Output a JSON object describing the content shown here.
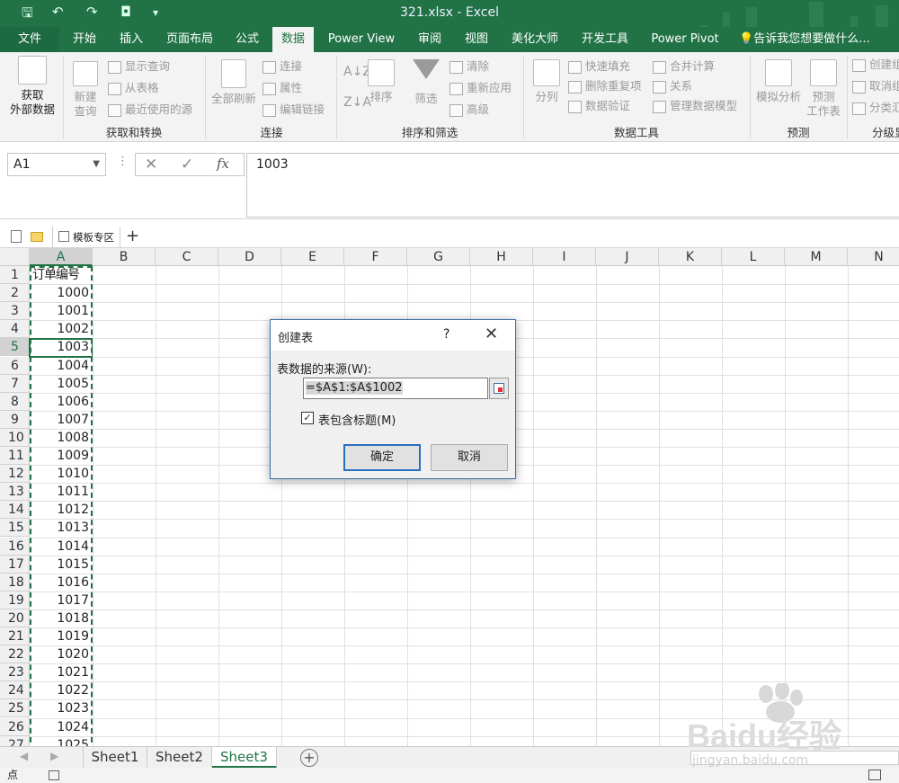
{
  "window": {
    "title": "321.xlsx - Excel"
  },
  "tabs": [
    "文件",
    "开始",
    "插入",
    "页面布局",
    "公式",
    "数据",
    "Power View",
    "审阅",
    "视图",
    "美化大师",
    "开发工具",
    "Power Pivot"
  ],
  "active_tab": "数据",
  "tell_me": "告诉我您想要做什么...",
  "ribbon": {
    "get_external": {
      "line1": "获取",
      "line2": "外部数据"
    },
    "new_query": {
      "line1": "新建",
      "line2": "查询"
    },
    "show_query": "显示查询",
    "from_table": "从表格",
    "recent_sources": "最近使用的源",
    "group_get_transform": "获取和转换",
    "refresh_all": "全部刷新",
    "connections": "连接",
    "properties": "属性",
    "edit_links": "编辑链接",
    "group_connections": "连接",
    "sort": "排序",
    "filter": "筛选",
    "clear": "清除",
    "reapply": "重新应用",
    "advanced": "高级",
    "group_sort_filter": "排序和筛选",
    "text_to_columns": "分列",
    "flash_fill": "快速填充",
    "remove_duplicates": "删除重复项",
    "data_validation": "数据验证",
    "consolidate": "合并计算",
    "relationships": "关系",
    "manage_data_model": "管理数据模型",
    "group_data_tools": "数据工具",
    "what_if": "模拟分析",
    "forecast_sheet": {
      "line1": "预测",
      "line2": "工作表"
    },
    "group_forecast": "预测",
    "group_create": "创建组",
    "ungroup": "取消组",
    "subtotal": "分类汇",
    "group_outline": "分级显"
  },
  "formula_bar": {
    "name_box": "A1",
    "fx": "fx",
    "value": "1003"
  },
  "template_tab": "模板专区",
  "columns": [
    "A",
    "B",
    "C",
    "D",
    "E",
    "F",
    "G",
    "H",
    "I",
    "J",
    "K",
    "L",
    "M",
    "N"
  ],
  "rows": [
    {
      "n": "1",
      "a": "订单编号"
    },
    {
      "n": "2",
      "a": "1000"
    },
    {
      "n": "3",
      "a": "1001"
    },
    {
      "n": "4",
      "a": "1002"
    },
    {
      "n": "5",
      "a": "1003"
    },
    {
      "n": "6",
      "a": "1004"
    },
    {
      "n": "7",
      "a": "1005"
    },
    {
      "n": "8",
      "a": "1006"
    },
    {
      "n": "9",
      "a": "1007"
    },
    {
      "n": "10",
      "a": "1008"
    },
    {
      "n": "11",
      "a": "1009"
    },
    {
      "n": "12",
      "a": "1010"
    },
    {
      "n": "13",
      "a": "1011"
    },
    {
      "n": "14",
      "a": "1012"
    },
    {
      "n": "15",
      "a": "1013"
    },
    {
      "n": "16",
      "a": "1014"
    },
    {
      "n": "17",
      "a": "1015"
    },
    {
      "n": "18",
      "a": "1016"
    },
    {
      "n": "19",
      "a": "1017"
    },
    {
      "n": "20",
      "a": "1018"
    },
    {
      "n": "21",
      "a": "1019"
    },
    {
      "n": "22",
      "a": "1020"
    },
    {
      "n": "23",
      "a": "1021"
    },
    {
      "n": "24",
      "a": "1022"
    },
    {
      "n": "25",
      "a": "1023"
    },
    {
      "n": "26",
      "a": "1024"
    },
    {
      "n": "27",
      "a": "1025"
    }
  ],
  "sheets": [
    "Sheet1",
    "Sheet2",
    "Sheet3"
  ],
  "active_sheet": "Sheet3",
  "status": "点",
  "dialog": {
    "title": "创建表",
    "help": "?",
    "close": "✕",
    "range_label": "表数据的来源(W):",
    "range_value": "=$A$1:$A$1002",
    "checkbox_label": "表包含标题(M)",
    "checkbox_checked": true,
    "ok": "确定",
    "cancel": "取消"
  },
  "watermark": {
    "brand": "Baidu经验",
    "url": "jingyan.baidu.com"
  }
}
